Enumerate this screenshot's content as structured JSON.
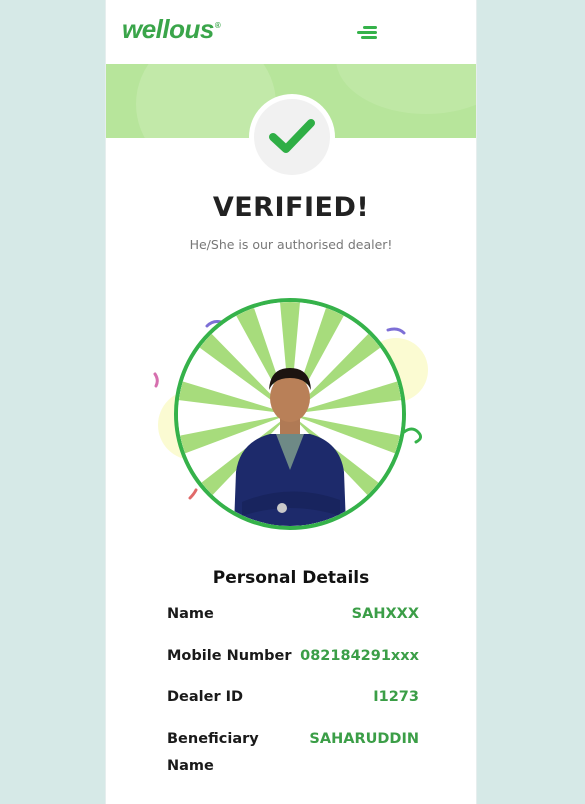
{
  "colors": {
    "brand_green": "#3aa54a",
    "banner_green": "#b7e59b",
    "check_green": "#2fae45",
    "value_green": "#3b9e47",
    "ring_green": "#35b24a",
    "page_bg": "#d6e9e7"
  },
  "header": {
    "logo_text": "wellous",
    "logo_mark": "®",
    "menu_icon": "menu-icon"
  },
  "verification": {
    "title": "VERIFIED!",
    "subtitle": "He/She is our authorised dealer!",
    "icon": "check-icon"
  },
  "photo": {
    "subject": "dealer-portrait"
  },
  "details": {
    "heading": "Personal Details",
    "rows": [
      {
        "label": "Name",
        "value": "SAHXXX"
      },
      {
        "label": "Mobile Number",
        "value": "082184291xxx"
      },
      {
        "label": "Dealer ID",
        "value": "I1273"
      },
      {
        "label": "Beneficiary\nName",
        "value": "SAHARUDDIN"
      }
    ]
  }
}
